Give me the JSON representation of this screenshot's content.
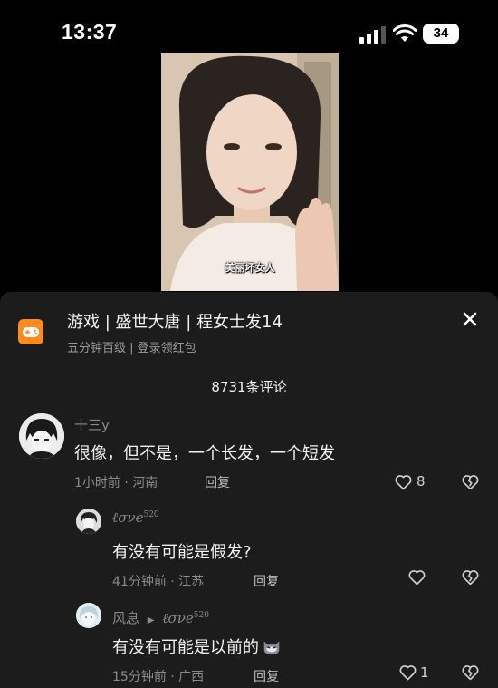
{
  "status_bar": {
    "time": "13:37",
    "battery": "34"
  },
  "video": {
    "caption": "美丽坏女人"
  },
  "header": {
    "title": "游戏 | 盛世大唐 | 程女士发14",
    "subtitle": "五分钟百级 | 登录领红包"
  },
  "comments": {
    "count_label": "8731条评论",
    "main": {
      "username": "十三y",
      "text": "很像，但不是，一个长发，一个短发",
      "meta": "1小时前 · 河南",
      "reply_label": "回复",
      "likes": "8"
    },
    "replies": [
      {
        "username": "ℓσνe",
        "username_sup": "520",
        "text": "有没有可能是假发?",
        "meta": "41分钟前 · 江苏",
        "reply_label": "回复",
        "likes": ""
      },
      {
        "username": "风息",
        "reply_to": "ℓσνe",
        "reply_to_sup": "520",
        "text": "有没有可能是以前的",
        "meta": "15分钟前 · 广西",
        "reply_label": "回复",
        "likes": "1"
      }
    ]
  },
  "icons": {
    "game": "gamepad-icon",
    "close": "close-icon",
    "like": "heart-icon",
    "dislike": "broken-heart-icon",
    "emoji": "cat-emoji-icon"
  },
  "colors": {
    "game_icon_bg": "#ff8a1e",
    "panel_bg": "#1c1c1c"
  }
}
